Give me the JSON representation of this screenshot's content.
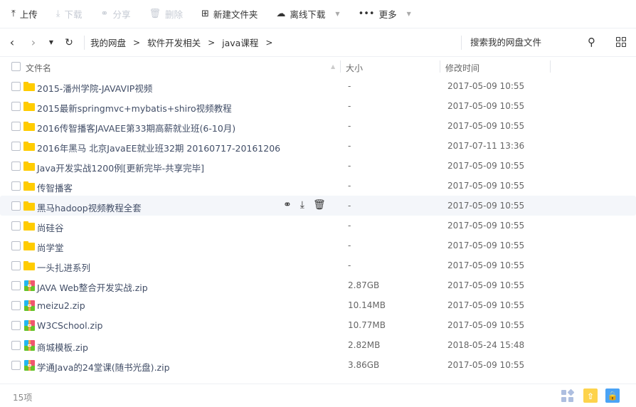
{
  "toolbar": {
    "upload": "上传",
    "download": "下载",
    "share": "分享",
    "delete": "删除",
    "new_folder": "新建文件夹",
    "offline": "离线下载",
    "more": "更多"
  },
  "nav": {
    "breadcrumb": [
      "我的网盘",
      "软件开发相关",
      "java课程"
    ],
    "search_placeholder": "搜索我的网盘文件"
  },
  "table": {
    "col_name": "文件名",
    "col_size": "大小",
    "col_time": "修改时间"
  },
  "files": [
    {
      "name": "2015-潘州学院-JAVAVIP视频",
      "size": "-",
      "time": "2017-05-09 10:55",
      "type": "folder"
    },
    {
      "name": "2015最新springmvc+mybatis+shiro视频教程",
      "size": "-",
      "time": "2017-05-09 10:55",
      "type": "folder"
    },
    {
      "name": "2016传智播客JAVAEE第33期高薪就业班(6-10月)",
      "size": "-",
      "time": "2017-05-09 10:55",
      "type": "folder"
    },
    {
      "name": "2016年黑马 北京JavaEE就业班32期 20160717-20161206",
      "size": "-",
      "time": "2017-07-11 13:36",
      "type": "folder"
    },
    {
      "name": "Java开发实战1200例[更新完毕-共享完毕]",
      "size": "-",
      "time": "2017-05-09 10:55",
      "type": "folder"
    },
    {
      "name": "传智播客",
      "size": "-",
      "time": "2017-05-09 10:55",
      "type": "folder"
    },
    {
      "name": "黑马hadoop视频教程全套",
      "size": "-",
      "time": "2017-05-09 10:55",
      "type": "folder"
    },
    {
      "name": "尚硅谷",
      "size": "-",
      "time": "2017-05-09 10:55",
      "type": "folder"
    },
    {
      "name": "尚学堂",
      "size": "-",
      "time": "2017-05-09 10:55",
      "type": "folder"
    },
    {
      "name": "一头扎进系列",
      "size": "-",
      "time": "2017-05-09 10:55",
      "type": "folder"
    },
    {
      "name": "JAVA  Web整合开发实战.zip",
      "size": "2.87GB",
      "time": "2017-05-09 10:55",
      "type": "zip"
    },
    {
      "name": "meizu2.zip",
      "size": "10.14MB",
      "time": "2017-05-09 10:55",
      "type": "zip"
    },
    {
      "name": "W3CSchool.zip",
      "size": "10.77MB",
      "time": "2017-05-09 10:55",
      "type": "zip"
    },
    {
      "name": "商城模板.zip",
      "size": "2.82MB",
      "time": "2018-05-24 15:48",
      "type": "zip"
    },
    {
      "name": "学通Java的24堂课(随书光盘).zip",
      "size": "3.86GB",
      "time": "2017-05-09 10:55",
      "type": "zip"
    }
  ],
  "footer": {
    "count": "15项"
  }
}
